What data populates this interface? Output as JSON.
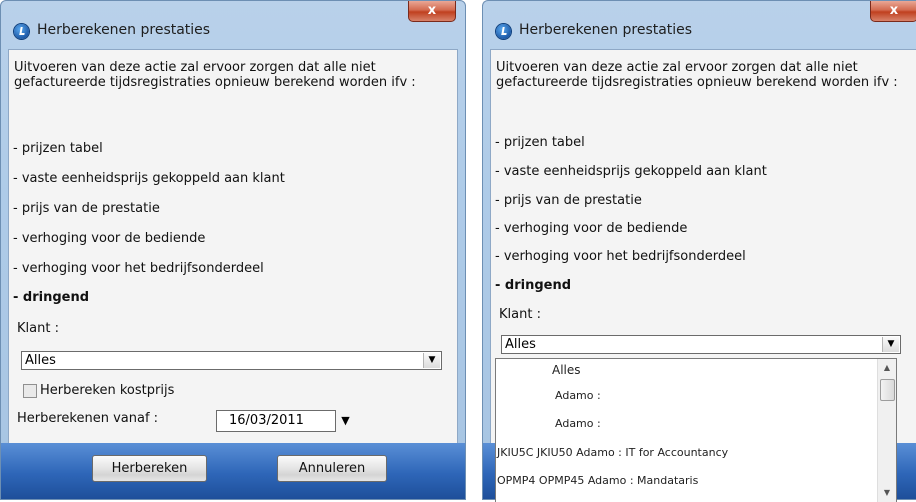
{
  "dialog_left": {
    "title": "Herberekenen prestaties",
    "close_label": "x",
    "intro": "Uitvoeren van deze actie zal ervoor zorgen dat alle niet gefactureerde tijdsregistraties opnieuw berekend worden ifv :",
    "items": [
      "- prijzen tabel",
      "- vaste eenheidsprijs gekoppeld aan klant",
      "- prijs van de prestatie",
      "- verhoging voor de bediende",
      "- verhoging voor het bedrijfsonderdeel",
      "- dringend"
    ],
    "klant_label": "Klant :",
    "klant_value": "Alles",
    "checkbox_label": "Herbereken kostprijs",
    "vanaf_label": "Herberekenen vanaf :",
    "vanaf_value": "16/03/2011",
    "herbereken_button": "Herbereken",
    "annuleren_button": "Annuleren"
  },
  "dialog_right": {
    "title": "Herberekenen prestaties",
    "close_label": "x",
    "intro": "Uitvoeren van deze actie zal ervoor zorgen dat alle niet gefactureerde tijdsregistraties opnieuw berekend worden ifv :",
    "items": [
      "- prijzen tabel",
      "- vaste eenheidsprijs gekoppeld aan klant",
      "- prijs van de prestatie",
      "- verhoging voor de bediende",
      "- verhoging voor het bedrijfsonderdeel",
      "- dringend"
    ],
    "klant_label": "Klant :",
    "klant_value": "Alles",
    "dropdown_options": [
      "Alles",
      "Adamo :",
      "Adamo :",
      "JKIU5C JKIU50 Adamo : IT for Accountancy",
      "OPMP4 OPMP45 Adamo : Mandataris"
    ]
  }
}
